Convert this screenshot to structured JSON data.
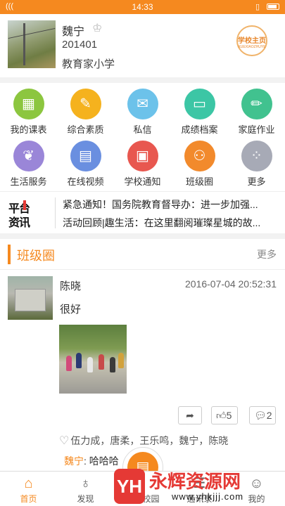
{
  "status_bar": {
    "time": "14:33"
  },
  "profile": {
    "name": "魏宁",
    "id": "201401",
    "school": "教育家小学",
    "homepage_badge": "学校主页",
    "homepage_badge_sub": "XUEXIAOZHUYE"
  },
  "grid": [
    {
      "label": "我的课表",
      "icon": "calendar-icon",
      "color": "#8cc63f"
    },
    {
      "label": "综合素质",
      "icon": "quality-icon",
      "color": "#f5b21e"
    },
    {
      "label": "私信",
      "icon": "mail-icon",
      "color": "#6cc2ea"
    },
    {
      "label": "成绩档案",
      "icon": "folder-icon",
      "color": "#3cc6a5"
    },
    {
      "label": "家庭作业",
      "icon": "pencil-icon",
      "color": "#41c28f"
    },
    {
      "label": "生活服务",
      "icon": "plant-icon",
      "color": "#9a86d8"
    },
    {
      "label": "在线视频",
      "icon": "film-icon",
      "color": "#6a8fe0"
    },
    {
      "label": "学校通知",
      "icon": "notice-icon",
      "color": "#e8574f"
    },
    {
      "label": "班级圈",
      "icon": "people-icon",
      "color": "#f28a2c"
    },
    {
      "label": "更多",
      "icon": "more-icon",
      "color": "#a7aab6"
    }
  ],
  "news": {
    "logo_line1": "平台",
    "logo_line2": "资讯",
    "items": [
      "紧急通知！国务院教育督导办：进一步加强...",
      "活动回顾|趣生活：在这里翻阅璀璨星城的故..."
    ]
  },
  "class_circle": {
    "title": "班级圈",
    "more": "更多"
  },
  "post": {
    "author": "陈晓",
    "time": "2016-07-04 20:52:31",
    "text": "很好",
    "likes_count": "5",
    "comments_count": "2",
    "liked_by": "伍力成，唐柔，王乐鸣，魏宁，陈晓",
    "comment_author": "魏宁",
    "comment_text": "哈哈哈"
  },
  "tabs": [
    {
      "label": "首页",
      "icon": "home-icon",
      "active": true
    },
    {
      "label": "发现",
      "icon": "planet-icon",
      "active": false
    },
    {
      "label": "智慧校园",
      "icon": "campus-icon",
      "active": false
    },
    {
      "label": "通讯录",
      "icon": "contacts-icon",
      "active": false
    },
    {
      "label": "我的",
      "icon": "profile-icon",
      "active": false
    }
  ],
  "watermark": {
    "logo": "YH",
    "title": "永辉资源网",
    "url": "www.yhkjjj.com"
  },
  "colors": {
    "accent": "#f5891f"
  }
}
